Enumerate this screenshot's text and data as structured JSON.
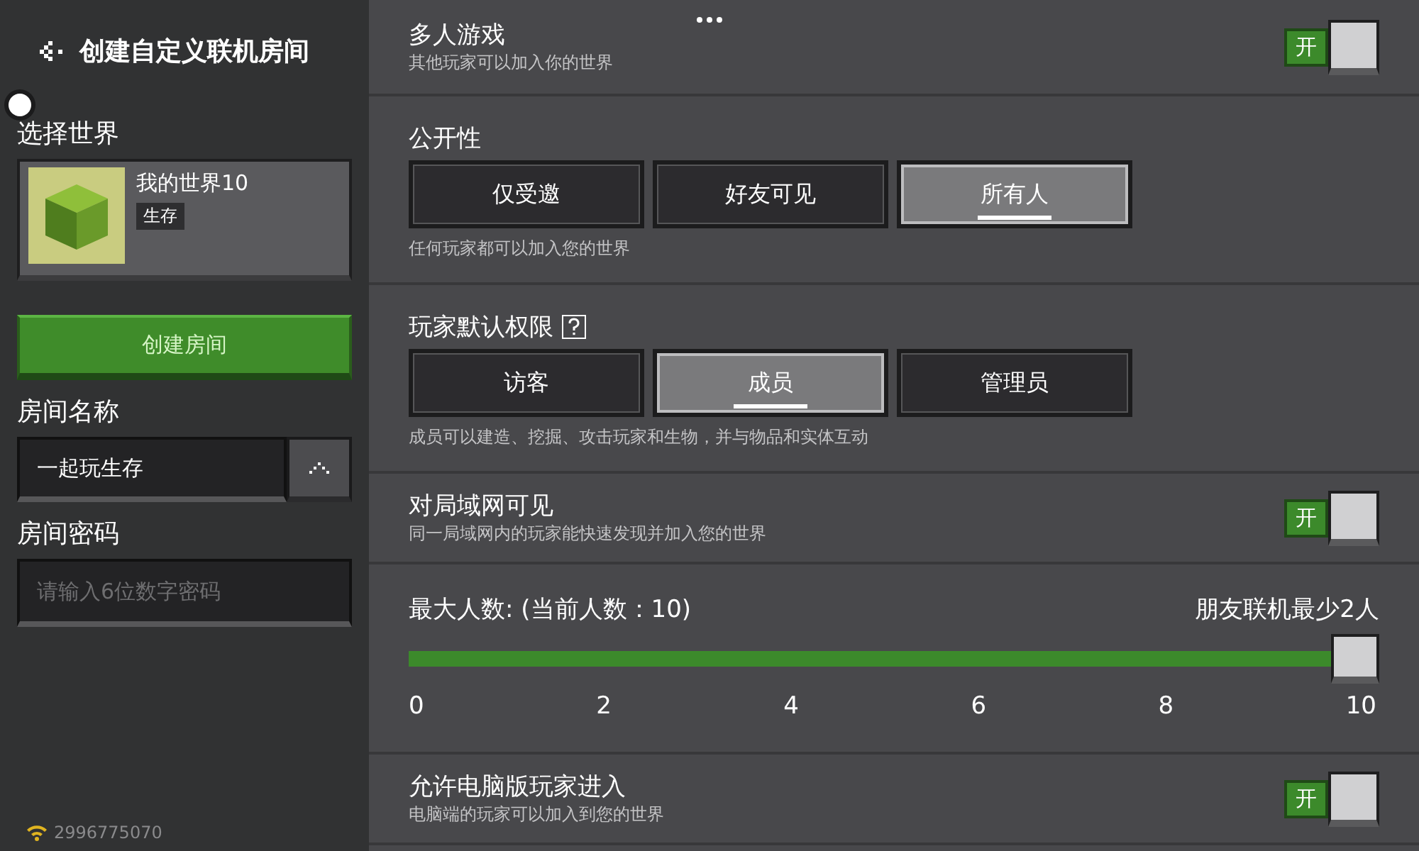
{
  "sidebar": {
    "title": "创建自定义联机房间",
    "world_section": {
      "label": "选择世界",
      "world": {
        "name": "我的世界10",
        "mode": "生存"
      }
    },
    "create_button": "创建房间",
    "room_name": {
      "label": "房间名称",
      "value": "一起玩生存"
    },
    "room_password": {
      "label": "房间密码",
      "placeholder": "请输入6位数字密码"
    },
    "footer": {
      "id": "2996775070"
    }
  },
  "settings": [
    {
      "kind": "toggle",
      "title": "多人游戏",
      "description": "其他玩家可以加入你的世界",
      "on": true,
      "toggle_label": "开"
    },
    {
      "kind": "choice",
      "title": "公开性",
      "help": false,
      "options": [
        {
          "label": "仅受邀",
          "selected": false
        },
        {
          "label": "好友可见",
          "selected": false
        },
        {
          "label": "所有人",
          "selected": true
        }
      ],
      "description": "任何玩家都可以加入您的世界"
    },
    {
      "kind": "choice",
      "title": "玩家默认权限",
      "help": true,
      "options": [
        {
          "label": "访客",
          "selected": false
        },
        {
          "label": "成员",
          "selected": true
        },
        {
          "label": "管理员",
          "selected": false
        }
      ],
      "description": "成员可以建造、挖掘、攻击玩家和生物，并与物品和实体互动"
    },
    {
      "kind": "toggle",
      "title": "对局域网可见",
      "description": "同一局域网内的玩家能快速发现并加入您的世界",
      "on": true,
      "toggle_label": "开"
    },
    {
      "kind": "slider",
      "title": "最大人数: (当前人数：10)",
      "note": "朋友联机最少2人",
      "level": 1,
      "ticks": [
        "0",
        "2",
        "4",
        "6",
        "8",
        "10"
      ]
    },
    {
      "kind": "toggle",
      "title": "允许电脑版玩家进入",
      "description": "电脑端的玩家可以加入到您的世界",
      "on": true,
      "toggle_label": "开"
    }
  ]
}
